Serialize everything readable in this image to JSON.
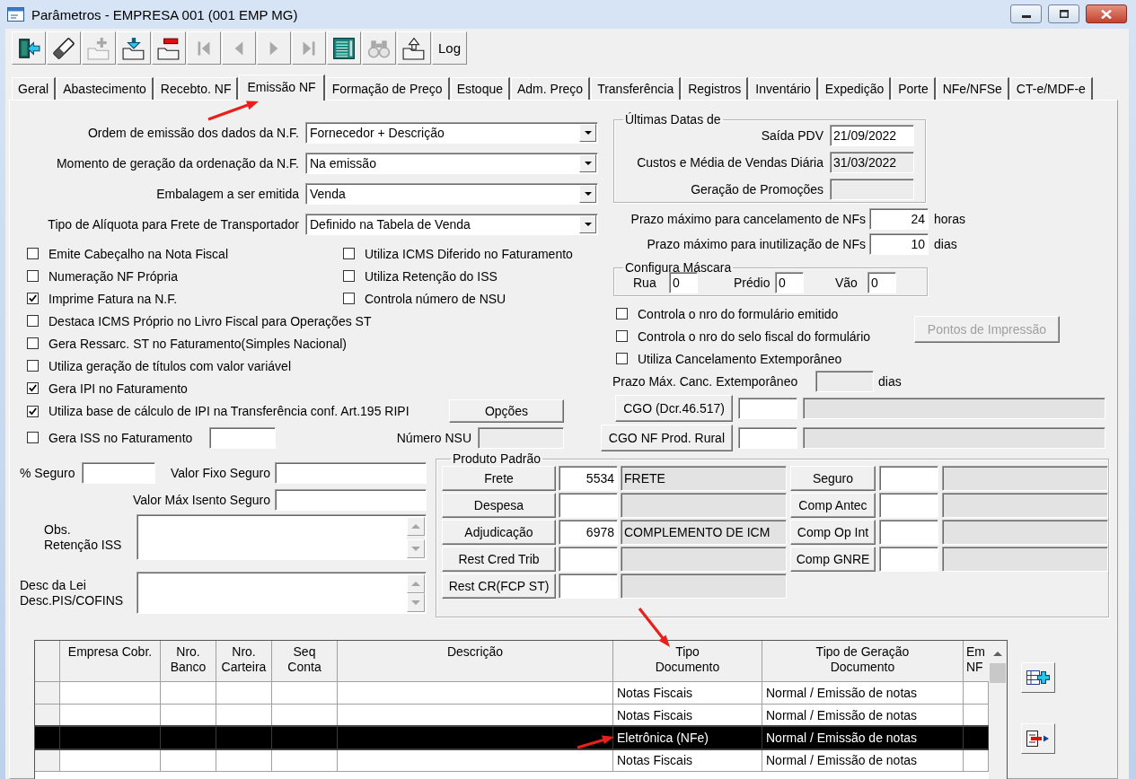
{
  "window": {
    "title": "Parâmetros - EMPRESA 001 (001 EMP MG)"
  },
  "toolbar": [
    {
      "kind": "exit",
      "disabled": false
    },
    {
      "kind": "erase",
      "disabled": false
    },
    {
      "kind": "add",
      "disabled": true
    },
    {
      "kind": "download",
      "disabled": false
    },
    {
      "kind": "remove",
      "disabled": false
    },
    {
      "kind": "first",
      "disabled": true
    },
    {
      "kind": "previous",
      "disabled": true
    },
    {
      "kind": "next",
      "disabled": true
    },
    {
      "kind": "last",
      "disabled": true
    },
    {
      "kind": "list",
      "disabled": false
    },
    {
      "kind": "find",
      "disabled": true
    },
    {
      "kind": "upload",
      "disabled": false
    },
    {
      "kind": "text",
      "label": "Log",
      "disabled": false
    }
  ],
  "tabs": [
    {
      "label": "Geral",
      "selected": false
    },
    {
      "label": "Abastecimento",
      "selected": false
    },
    {
      "label": "Recebto. NF",
      "selected": false
    },
    {
      "label": "Emissão NF",
      "selected": true
    },
    {
      "label": "Formação de Preço",
      "selected": false
    },
    {
      "label": "Estoque",
      "selected": false
    },
    {
      "label": "Adm. Preço",
      "selected": false
    },
    {
      "label": "Transferência",
      "selected": false
    },
    {
      "label": "Registros",
      "selected": false
    },
    {
      "label": "Inventário",
      "selected": false
    },
    {
      "label": "Expedição",
      "selected": false
    },
    {
      "label": "Porte",
      "selected": false
    },
    {
      "label": "NFe/NFSe",
      "selected": false
    },
    {
      "label": "CT-e/MDF-e",
      "selected": false
    }
  ],
  "general": {
    "selects": [
      {
        "label": "Ordem de emissão dos dados da N.F.",
        "value": "Fornecedor + Descrição"
      },
      {
        "label": "Momento de geração da ordenação da N.F.",
        "value": "Na emissão"
      },
      {
        "label": "Embalagem a ser emitida",
        "value": "Venda"
      },
      {
        "label": "Tipo de Alíquota para Frete de Transportador",
        "value": "Definido na Tabela de Venda"
      }
    ],
    "checks_left": [
      {
        "label": "Emite Cabeçalho na Nota Fiscal",
        "checked": false
      },
      {
        "label": "Numeração NF Própria",
        "checked": false
      },
      {
        "label": "Imprime Fatura na N.F.",
        "checked": true
      }
    ],
    "checks_right": [
      {
        "label": "Utiliza ICMS Diferido no Faturamento",
        "checked": false
      },
      {
        "label": "Utiliza Retenção do ISS",
        "checked": false
      },
      {
        "label": "Controla número de NSU",
        "checked": false
      }
    ],
    "checks": [
      {
        "label": "Destaca ICMS Próprio no Livro Fiscal para Operações ST",
        "checked": false
      },
      {
        "label": "Gera Ressarc. ST no Faturamento(Simples Nacional)",
        "checked": false
      },
      {
        "label": "Utiliza geração de títulos com valor variável",
        "checked": false
      },
      {
        "label": "Gera IPI no Faturamento",
        "checked": true
      }
    ],
    "ipi_transfer": {
      "label": "Utiliza base de cálculo de IPI na Transferência conf. Art.195 RIPI",
      "checked": true,
      "button": "Opções"
    },
    "iss": {
      "label": "Gera ISS no Faturamento",
      "checked": false
    },
    "nsu": {
      "label": "Número NSU",
      "disabled": true
    }
  },
  "last_dates": {
    "legend": "Últimas Datas de",
    "fields": [
      {
        "label": "Saída PDV",
        "value": "21/09/2022",
        "disabled": false
      },
      {
        "label": "Custos e Média de Vendas Diária",
        "value": "31/03/2022",
        "disabled": true
      },
      {
        "label": "Geração de Promoções",
        "disabled": true
      }
    ]
  },
  "deadlines": [
    {
      "label": "Prazo máximo para cancelamento de NFs",
      "value": "24",
      "unit": "horas"
    },
    {
      "label": "Prazo máximo para inutilização de NFs",
      "value": "10",
      "unit": "dias"
    }
  ],
  "mask": {
    "legend": "Configura Máscara",
    "fields": [
      {
        "label": "Rua",
        "value": "0"
      },
      {
        "label": "Prédio",
        "value": "0"
      },
      {
        "label": "Vão",
        "value": "0"
      }
    ]
  },
  "form_checks": [
    {
      "label": "Controla o nro do formulário emitido",
      "checked": false
    },
    {
      "label": "Controla o nro do selo fiscal do formulário",
      "checked": false
    },
    {
      "label": "Utiliza Cancelamento Extemporâneo",
      "checked": false
    }
  ],
  "print_points_button": {
    "label": "Pontos de Impressão",
    "disabled": true
  },
  "late_cancel": {
    "label": "Prazo Máx. Canc. Extemporâneo",
    "unit": "dias",
    "disabled": true
  },
  "cgo": [
    {
      "button": "CGO (Dcr.46.517)"
    },
    {
      "button": "CGO NF Prod. Rural"
    }
  ],
  "insurance": {
    "percent_label": "% Seguro",
    "fixed_label": "Valor Fixo Seguro",
    "max_label": "Valor Máx Isento Seguro"
  },
  "notes": [
    {
      "lines": [
        "Obs.",
        "Retenção ISS"
      ]
    },
    {
      "lines": [
        "Desc da Lei",
        "Desc.PIS/COFINS"
      ]
    }
  ],
  "default_products": {
    "legend": "Produto Padrão",
    "left": [
      {
        "button": "Frete",
        "code": "5534",
        "description": "FRETE"
      },
      {
        "button": "Despesa"
      },
      {
        "button": "Adjudicação",
        "code": "6978",
        "description": "COMPLEMENTO DE ICM"
      },
      {
        "button": "Rest Cred Trib"
      },
      {
        "button": "Rest CR(FCP ST)"
      }
    ],
    "right": [
      {
        "button": "Seguro"
      },
      {
        "button": "Comp Antec"
      },
      {
        "button": "Comp Op Int"
      },
      {
        "button": "Comp GNRE"
      }
    ]
  },
  "grid": {
    "columns": [
      {
        "lines": [
          "Empresa Cobr."
        ]
      },
      {
        "lines": [
          "Nro.",
          "Banco"
        ]
      },
      {
        "lines": [
          "Nro.",
          "Carteira"
        ]
      },
      {
        "lines": [
          "Seq",
          "Conta"
        ]
      },
      {
        "lines": [
          "Descrição"
        ]
      },
      {
        "lines": [
          "Tipo",
          "Documento"
        ]
      },
      {
        "lines": [
          "Tipo de Geração",
          "Documento"
        ]
      },
      {
        "lines": [
          "Em",
          "NF"
        ]
      }
    ],
    "rows": [
      {
        "cells": [
          null,
          null,
          null,
          null,
          null,
          "Notas Fiscais",
          "Normal / Emissão de notas",
          null
        ],
        "selected": false
      },
      {
        "cells": [
          null,
          null,
          null,
          null,
          null,
          "Notas Fiscais",
          "Normal / Emissão de notas",
          null
        ],
        "selected": false
      },
      {
        "cells": [
          null,
          null,
          null,
          null,
          null,
          "Eletrônica (NFe)",
          "Normal / Emissão de notas",
          null
        ],
        "selected": true
      },
      {
        "cells": [
          null,
          null,
          null,
          null,
          null,
          "Notas Fiscais",
          "Normal / Emissão de notas",
          null
        ],
        "selected": false
      }
    ]
  }
}
